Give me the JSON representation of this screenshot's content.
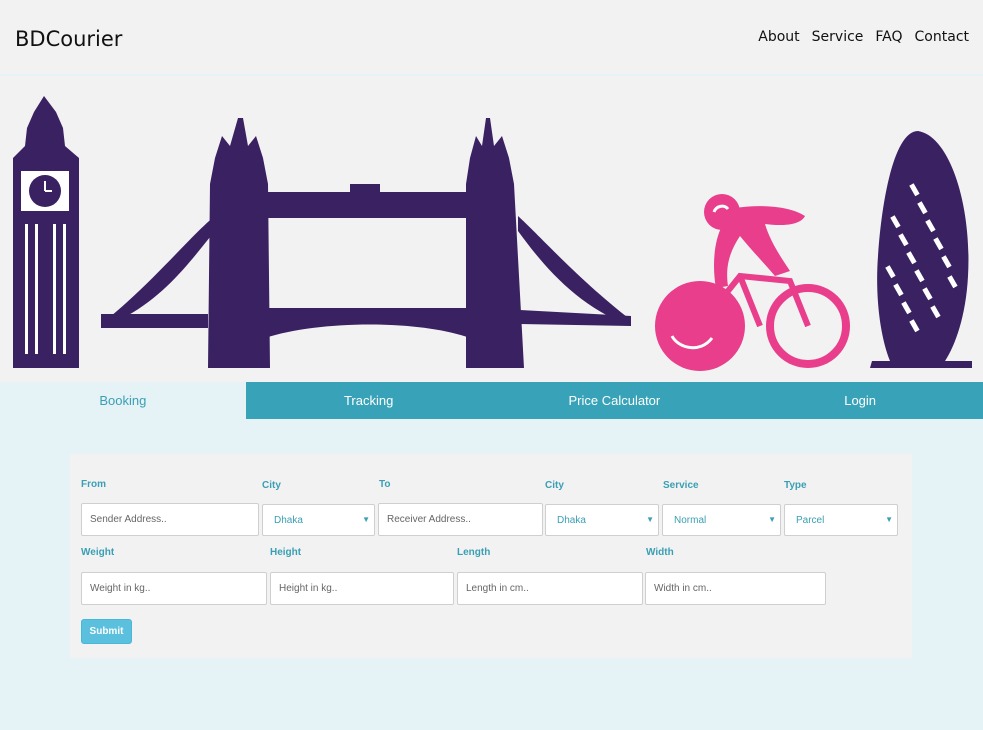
{
  "header": {
    "brand": "BDCourier",
    "nav": [
      "About",
      "Service",
      "FAQ",
      "Contact"
    ]
  },
  "tabs": [
    "Booking",
    "Tracking",
    "Price Calculator",
    "Login"
  ],
  "active_tab": "Booking",
  "form": {
    "labels": {
      "from": "From",
      "city1": "City",
      "to": "To",
      "city2": "City",
      "service": "Service",
      "type": "Type",
      "weight": "Weight",
      "height": "Height",
      "length": "Length",
      "width": "Width"
    },
    "placeholders": {
      "sender": "Sender Address..",
      "receiver": "Receiver Address..",
      "weight": "Weight in kg..",
      "height": "Height in kg..",
      "length": "Length in cm..",
      "width": "Width in cm.."
    },
    "selects": {
      "city1": "Dhaka",
      "city2": "Dhaka",
      "service": "Normal",
      "type": "Parcel"
    },
    "submit_label": "Submit"
  },
  "colors": {
    "accent": "#38a3b8",
    "silhouette": "#3a2161",
    "cyclist": "#e83e8c",
    "page_bg": "#e5f2f6"
  },
  "hero_icons": [
    "big-ben-icon",
    "tower-bridge-icon",
    "cyclist-icon",
    "gherkin-icon"
  ]
}
